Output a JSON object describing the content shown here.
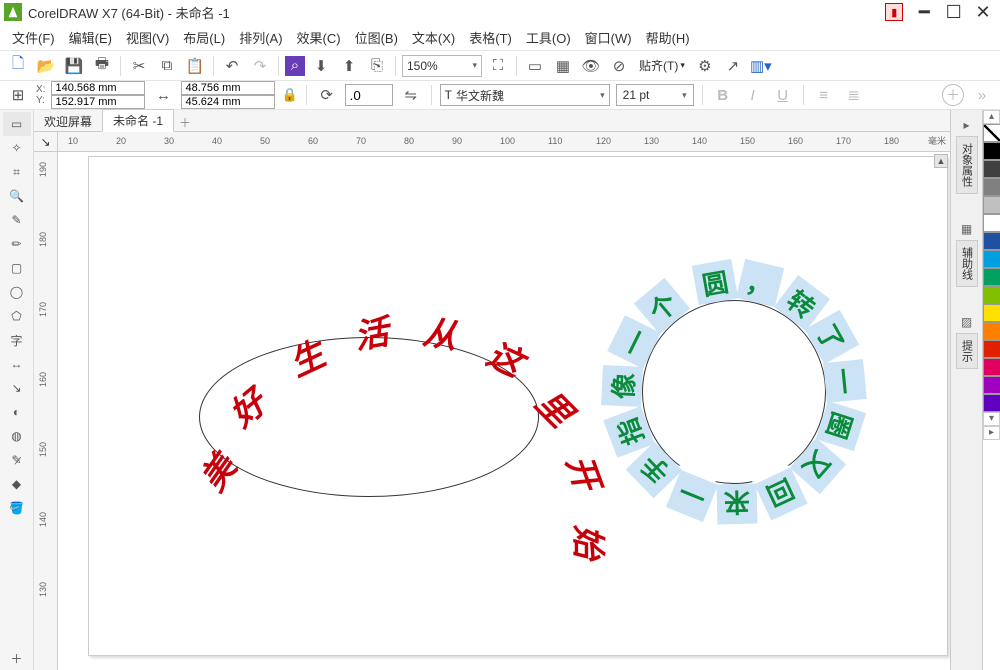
{
  "title": "CorelDRAW X7 (64-Bit) - 未命名 -1",
  "menus": [
    "文件(F)",
    "编辑(E)",
    "视图(V)",
    "布局(L)",
    "排列(A)",
    "效果(C)",
    "位图(B)",
    "文本(X)",
    "表格(T)",
    "工具(O)",
    "窗口(W)",
    "帮助(H)"
  ],
  "zoom": "150%",
  "paste_label": "贴齐(T)",
  "coords": {
    "x": "140.568 mm",
    "y": "152.917 mm",
    "w": "48.756 mm",
    "h": "45.624 mm"
  },
  "rotation": ".0",
  "font_name": "华文新魏",
  "font_size": "21 pt",
  "tabs": {
    "welcome": "欢迎屏幕",
    "doc": "未命名 -1"
  },
  "ruler_unit": "毫米",
  "ruler_h_ticks": [
    10,
    20,
    30,
    40,
    50,
    60,
    70,
    80,
    90,
    100,
    110,
    120,
    130,
    140,
    150,
    160,
    170,
    180
  ],
  "ruler_v_ticks": [
    190,
    180,
    170,
    160,
    150,
    140,
    130
  ],
  "dock_tabs": [
    "对象属性",
    "辅助线",
    "提示"
  ],
  "art_red_chars": [
    "美",
    "好",
    "生",
    "活",
    "从",
    "这",
    "里",
    "开",
    "始"
  ],
  "art_green_chars": [
    "圆",
    "，",
    "转",
    "了",
    "一",
    "圈",
    "又",
    "回",
    "来",
    "一",
    "手",
    "指",
    "像",
    "一",
    "个"
  ],
  "palette": [
    "none",
    "#000000",
    "#404040",
    "#808080",
    "#c0c0c0",
    "#ffffff",
    "#2050a0",
    "#00a0e0",
    "#00a060",
    "#80c000",
    "#ffe000",
    "#ff8000",
    "#e02000",
    "#e00060",
    "#a000c0",
    "#6000c0"
  ]
}
